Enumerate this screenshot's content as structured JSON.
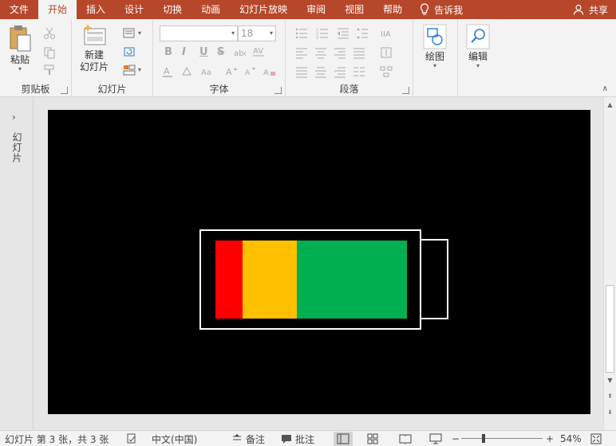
{
  "menu": {
    "tabs": [
      "文件",
      "开始",
      "插入",
      "设计",
      "切换",
      "动画",
      "幻灯片放映",
      "审阅",
      "视图",
      "帮助"
    ],
    "active_index": 1,
    "tell_me": "告诉我",
    "share": "共享"
  },
  "ribbon": {
    "clipboard": {
      "paste": "粘贴",
      "label": "剪贴板"
    },
    "slides": {
      "new_line1": "新建",
      "new_line2": "幻灯片",
      "label": "幻灯片"
    },
    "font": {
      "size_value": "18",
      "bold": "B",
      "italic": "I",
      "underline": "U",
      "strike": "S",
      "label": "字体"
    },
    "paragraph": {
      "label": "段落"
    },
    "drawing": {
      "label": "绘图"
    },
    "editing": {
      "label": "编辑"
    }
  },
  "thumbnails": {
    "label": "幻灯片"
  },
  "battery": {
    "levels": [
      {
        "name": "red",
        "fraction": 0.14,
        "color": "#ff0000"
      },
      {
        "name": "yellow",
        "fraction": 0.285,
        "color": "#ffc000"
      },
      {
        "name": "green",
        "fraction": 0.575,
        "color": "#00b050"
      }
    ]
  },
  "status": {
    "slide_info": "幻灯片 第 3 张，共 3 张",
    "language": "中文(中国)",
    "notes": "备注",
    "comments": "批注",
    "zoom_minus": "−",
    "zoom_plus": "+",
    "zoom": "54%"
  },
  "colors": {
    "accent": "#b7472a",
    "slide_bg": "#000000"
  }
}
